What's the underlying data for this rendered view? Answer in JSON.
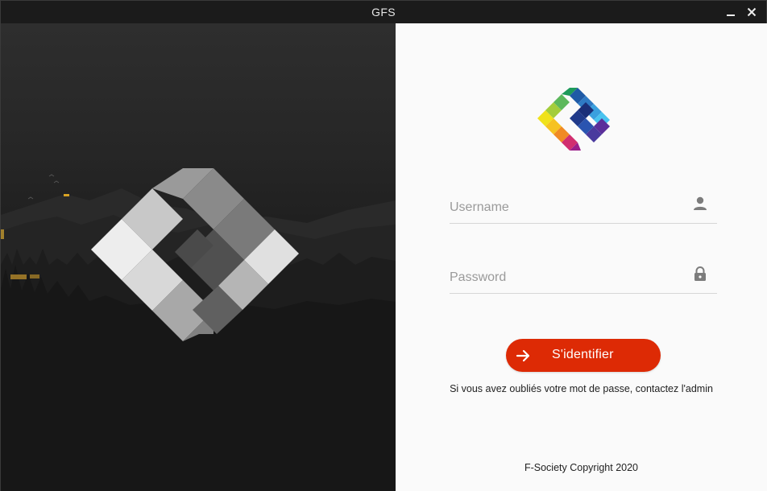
{
  "window": {
    "title": "GFS",
    "minimize_icon": "minimize-icon",
    "close_icon": "close-icon"
  },
  "left_panel": {
    "background": "dark-forest-landscape",
    "logo": "gfs-logo-grayscale"
  },
  "login": {
    "logo": "gfs-logo-color",
    "username": {
      "placeholder": "Username",
      "value": "",
      "icon": "user-icon"
    },
    "password": {
      "placeholder": "Password",
      "value": "",
      "icon": "lock-icon"
    },
    "submit_label": "S'identifier",
    "submit_icon": "arrow-right-icon",
    "forgot_text": "Si vous avez oubliés votre mot de passe, contactez l'admin",
    "copyright": "F-Society Copyright 2020"
  },
  "colors": {
    "accent": "#dd2a05",
    "right_background": "#fafafa",
    "titlebar": "#1b1b1b"
  }
}
